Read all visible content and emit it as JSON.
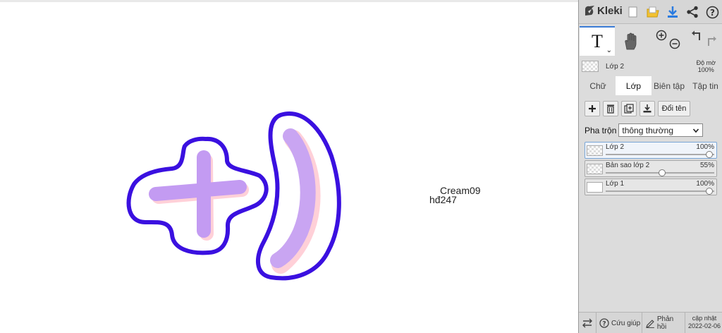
{
  "app": {
    "name": "Kleki"
  },
  "canvas": {
    "text1": "Cream09",
    "text2": "hđ247"
  },
  "header_icons": [
    "new-image-icon",
    "open-folder-icon",
    "download-icon",
    "share-icon",
    "help-icon"
  ],
  "tools": {
    "text_tool": "T",
    "hand_tool_icon": "hand-icon"
  },
  "current_layer": {
    "name": "Lớp 2",
    "opacity_label": "Độ mờ",
    "opacity_value": "100%"
  },
  "tabs": [
    {
      "label": "Chữ",
      "active": false
    },
    {
      "label": "Lớp",
      "active": true
    },
    {
      "label": "Biên tập",
      "active": false
    },
    {
      "label": "Tập tin",
      "active": false
    }
  ],
  "layer_panel": {
    "rename_label": "Đổi tên",
    "blend_label": "Pha trộn",
    "blend_value": "thông thường",
    "layers": [
      {
        "name": "Lớp 2",
        "opacity": "100%",
        "opacity_fraction": 1.0,
        "active": true
      },
      {
        "name": "Bản sao lớp 2",
        "opacity": "55%",
        "opacity_fraction": 0.55,
        "active": false
      },
      {
        "name": "Lớp 1",
        "opacity": "100%",
        "opacity_fraction": 1.0,
        "active": false
      }
    ]
  },
  "bottom_bar": {
    "help_label": "Cứu giúp",
    "feedback_label": "Phản hồi",
    "update_label": "cập nhật",
    "update_date": "2022-02-06"
  },
  "colors": {
    "outline": "#3a10e0",
    "fill": "#c39bf2",
    "shadow": "#ffd0d8",
    "accent": "#3a7bd5"
  }
}
